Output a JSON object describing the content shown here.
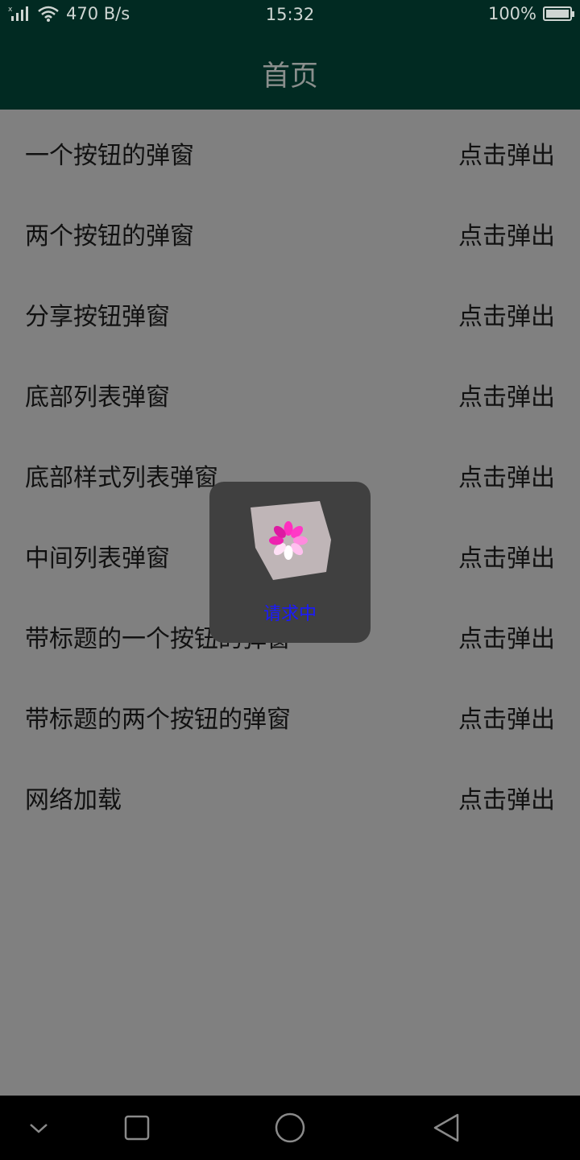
{
  "status_bar": {
    "network_speed": "470 B/s",
    "time": "15:32",
    "battery": "100%",
    "battery_level": 1.0
  },
  "app_bar": {
    "title": "首页"
  },
  "list": [
    {
      "label": "一个按钮的弹窗",
      "action": "点击弹出"
    },
    {
      "label": "两个按钮的弹窗",
      "action": "点击弹出"
    },
    {
      "label": "分享按钮弹窗",
      "action": "点击弹出"
    },
    {
      "label": "底部列表弹窗",
      "action": "点击弹出"
    },
    {
      "label": "底部样式列表弹窗",
      "action": "点击弹出"
    },
    {
      "label": "中间列表弹窗",
      "action": "点击弹出"
    },
    {
      "label": "带标题的一个按钮的弹窗",
      "action": "点击弹出"
    },
    {
      "label": "带标题的两个按钮的弹窗",
      "action": "点击弹出"
    },
    {
      "label": "网络加载",
      "action": "点击弹出"
    }
  ],
  "loading": {
    "text": "请求中",
    "icon": "loading-spinner-icon"
  },
  "nav_bar": {
    "icons": [
      "chevron-down-icon",
      "recents-square-icon",
      "home-circle-icon",
      "back-triangle-icon"
    ]
  },
  "colors": {
    "app_bar_bg": "#012a22",
    "overlay_bg": "#808080",
    "dialog_bg": "#404040",
    "loading_text": "#1a1aff",
    "spinner_petals": "#ff33cc"
  }
}
